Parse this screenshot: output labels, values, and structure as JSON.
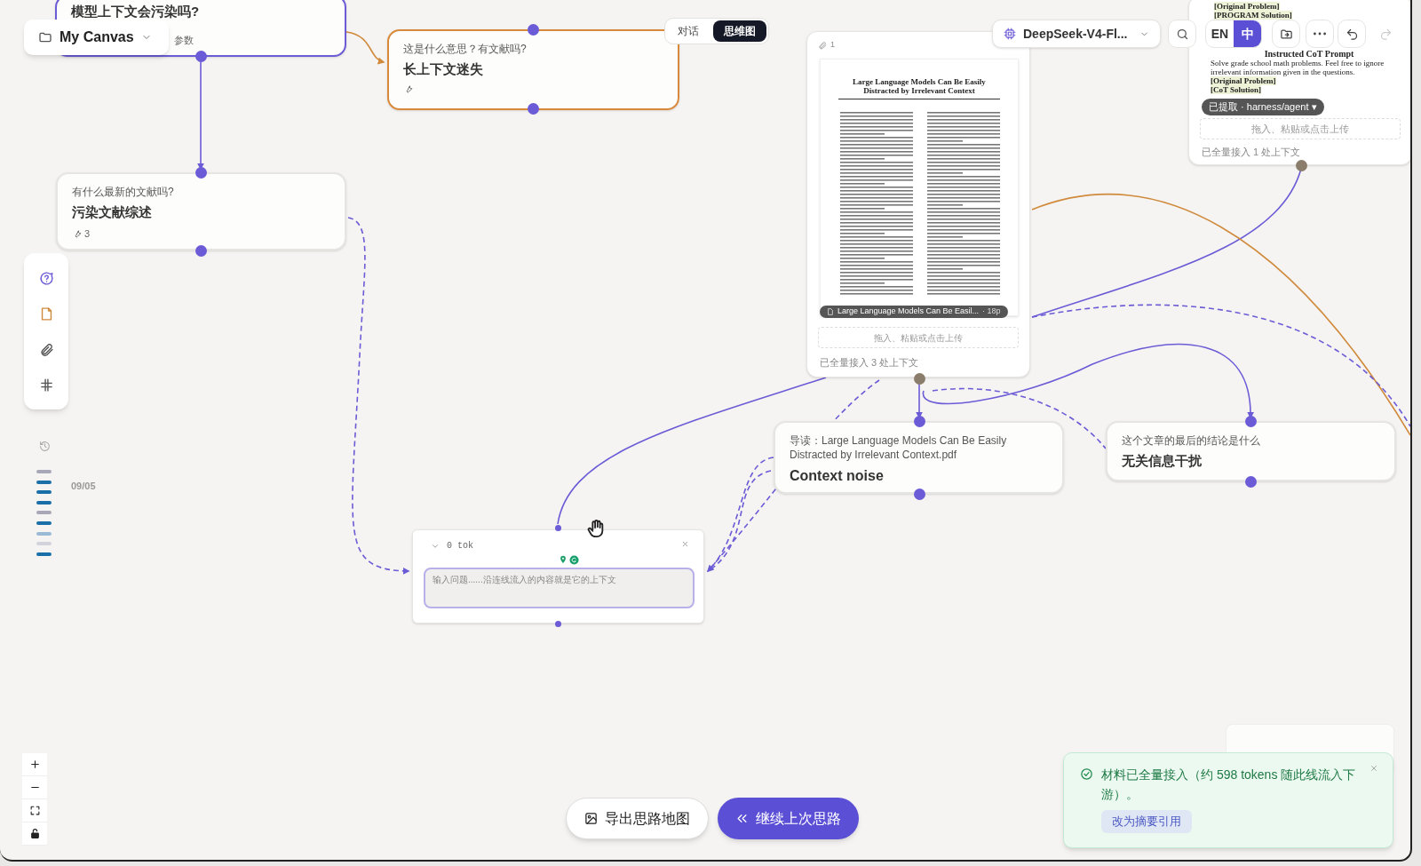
{
  "canvas_menu": {
    "label": "My Canvas"
  },
  "view_toggle": [
    {
      "label": "对话",
      "selected": false
    },
    {
      "label": "思维图",
      "selected": true
    }
  ],
  "model_selector": {
    "label": "DeepSeek-V4-Fl..."
  },
  "language_toggle": [
    {
      "label": "EN",
      "selected": false
    },
    {
      "label": "中",
      "selected": true
    }
  ],
  "nodes": [
    {
      "title": "模型上下文会污染吗?",
      "meta": "参数",
      "color": "#6b5bd6"
    },
    {
      "question": "这是什么意思？有文献吗?",
      "title": "长上下文迷失",
      "show_tools": true,
      "color": "#d9893a"
    },
    {
      "question": "有什么最新的文献吗?",
      "title": "污染文献综述",
      "show_tools": true,
      "tool_count": "3"
    },
    {
      "question": "导读：Large Language Models Can Be Easily Distracted by Irrelevant Context.pdf",
      "title": "Context noise"
    },
    {
      "question": "这个文章的最后的结论是什么",
      "title": "无关信息干扰"
    }
  ],
  "pdf_card": {
    "attachment_count": "1",
    "document_title": "Large Language Models Can Be Easily Distracted by Irrelevant Context",
    "file_chip": "Large Language Models Can Be Easil...",
    "pages": "· 18p",
    "dropzone": "拖入、粘贴或点击上传",
    "status": "已全量接入 3 处上下文"
  },
  "excerpt_card": {
    "top_lines": [
      "[Original Problem]",
      "[PROGRAM Solution]"
    ],
    "heading": "Instructed CoT Prompt",
    "body": "Solve grade school math problems. Feel free to ignore irrelevant information given in the questions.",
    "bottom_lines": [
      "[Original Problem]",
      "[CoT Solution]"
    ],
    "badge": "已提取 · harness/agent ▾",
    "dropzone": "拖入、粘贴或点击上传",
    "status": "已全量接入 1 处上下文"
  },
  "input_node": {
    "tokens": "0 tok",
    "placeholder": "输入问题......沿连线流入的内容就是它的上下文"
  },
  "history": {
    "date": "09/05",
    "bars": [
      {
        "color": "#a7a7b8"
      },
      {
        "color": "#1b6fa8"
      },
      {
        "color": "#1b6fa8"
      },
      {
        "color": "#1b6fa8"
      },
      {
        "color": "#a7a7b8"
      },
      {
        "color": "#1b6fa8"
      },
      {
        "color": "#9bbad6"
      },
      {
        "color": "#d3d3db"
      },
      {
        "color": "#1b6fa8"
      }
    ]
  },
  "actions": [
    {
      "label": "导出思路地图",
      "kind": "secondary"
    },
    {
      "label": "继续上次思路",
      "kind": "primary"
    }
  ],
  "toast": {
    "message": "材料已全量接入（约 598 tokens 随此线流入下游）。",
    "action": "改为摘要引用"
  }
}
